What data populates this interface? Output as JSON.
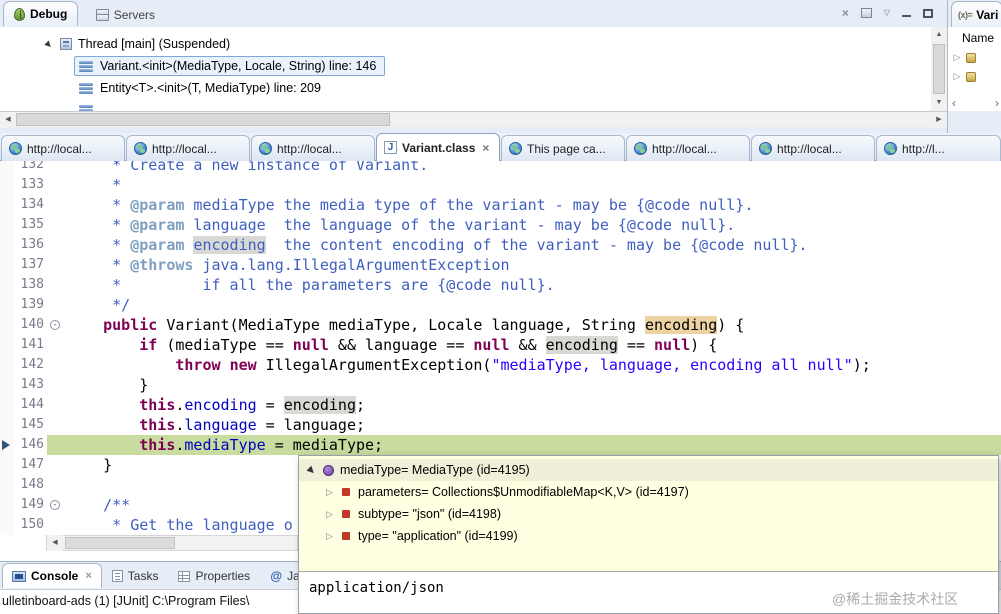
{
  "debug_view": {
    "tabs": [
      {
        "label": "Debug",
        "icon": "bug-icon",
        "active": true
      },
      {
        "label": "Servers",
        "icon": "servers-icon",
        "active": false
      }
    ],
    "toolbar_icons": [
      "remove-terminated-icon",
      "window-icon",
      "view-menu-icon",
      "minimize-icon",
      "maximize-icon"
    ],
    "thread_label": "Thread [main] (Suspended)",
    "frames": [
      {
        "label": "Variant.<init>(MediaType, Locale, String) line: 146",
        "selected": true
      },
      {
        "label": "Entity<T>.<init>(T, MediaType) line: 209",
        "selected": false
      }
    ]
  },
  "variables_view": {
    "tab_icon": "(x)=",
    "tab_label": "Vari",
    "name_header": "Name"
  },
  "editor": {
    "tabs": [
      {
        "label": "http://local...",
        "icon": "globe",
        "active": false
      },
      {
        "label": "http://local...",
        "icon": "globe",
        "active": false
      },
      {
        "label": "http://local...",
        "icon": "globe",
        "active": false
      },
      {
        "label": "Variant.class",
        "icon": "java-class",
        "active": true
      },
      {
        "label": "This page ca...",
        "icon": "globe",
        "active": false
      },
      {
        "label": "http://local...",
        "icon": "globe",
        "active": false
      },
      {
        "label": "http://local...",
        "icon": "globe",
        "active": false
      },
      {
        "label": "http://l...",
        "icon": "globe",
        "active": false
      }
    ],
    "code_lines": [
      {
        "num": "132",
        "tokens": [
          [
            "doc",
            "     * Create a new instance of Variant."
          ]
        ]
      },
      {
        "num": "133",
        "tokens": [
          [
            "doc",
            "     *"
          ]
        ]
      },
      {
        "num": "134",
        "tokens": [
          [
            "doc",
            "     * "
          ],
          [
            "doctag",
            "@param"
          ],
          [
            "doc",
            " mediaType the media type of the variant - may be {@code null}."
          ]
        ]
      },
      {
        "num": "135",
        "tokens": [
          [
            "doc",
            "     * "
          ],
          [
            "doctag",
            "@param"
          ],
          [
            "doc",
            " language  the language of the variant - may be {@code null}."
          ]
        ]
      },
      {
        "num": "136",
        "tokens": [
          [
            "doc",
            "     * "
          ],
          [
            "doctag",
            "@param"
          ],
          [
            "doc",
            " "
          ],
          [
            "docw",
            "encoding"
          ],
          [
            "doc",
            "  the content encoding of the variant - may be {@code null}."
          ]
        ]
      },
      {
        "num": "137",
        "tokens": [
          [
            "doc",
            "     * "
          ],
          [
            "doctag",
            "@throws"
          ],
          [
            "doc",
            " java.lang.IllegalArgumentException"
          ]
        ]
      },
      {
        "num": "138",
        "tokens": [
          [
            "doc",
            "     *         if all the parameters are {@code null}."
          ]
        ]
      },
      {
        "num": "139",
        "tokens": [
          [
            "doc",
            "     */"
          ]
        ]
      },
      {
        "num": "140",
        "fold": true,
        "tokens": [
          [
            "plain",
            "    "
          ],
          [
            "kw",
            "public"
          ],
          [
            "plain",
            " Variant(MediaType mediaType, Locale language, String "
          ],
          [
            "occw",
            "encoding"
          ],
          [
            "plain",
            ") {"
          ]
        ]
      },
      {
        "num": "141",
        "tokens": [
          [
            "plain",
            "        "
          ],
          [
            "kw",
            "if"
          ],
          [
            "plain",
            " (mediaType == "
          ],
          [
            "kw",
            "null"
          ],
          [
            "plain",
            " && language == "
          ],
          [
            "kw",
            "null"
          ],
          [
            "plain",
            " && "
          ],
          [
            "occ",
            "encoding"
          ],
          [
            "plain",
            " == "
          ],
          [
            "kw",
            "null"
          ],
          [
            "plain",
            ") {"
          ]
        ]
      },
      {
        "num": "142",
        "tokens": [
          [
            "plain",
            "            "
          ],
          [
            "kw",
            "throw"
          ],
          [
            "plain",
            " "
          ],
          [
            "kw",
            "new"
          ],
          [
            "plain",
            " IllegalArgumentException("
          ],
          [
            "str",
            "\"mediaType, language, encoding all null\""
          ],
          [
            "plain",
            ");"
          ]
        ]
      },
      {
        "num": "143",
        "tokens": [
          [
            "plain",
            "        }"
          ]
        ]
      },
      {
        "num": "144",
        "tokens": [
          [
            "plain",
            "        "
          ],
          [
            "kw",
            "this"
          ],
          [
            "plain",
            "."
          ],
          [
            "field",
            "encoding"
          ],
          [
            "plain",
            " = "
          ],
          [
            "occ",
            "encoding"
          ],
          [
            "plain",
            ";"
          ]
        ]
      },
      {
        "num": "145",
        "tokens": [
          [
            "plain",
            "        "
          ],
          [
            "kw",
            "this"
          ],
          [
            "plain",
            "."
          ],
          [
            "field",
            "language"
          ],
          [
            "plain",
            " = language;"
          ]
        ]
      },
      {
        "num": "146",
        "current": true,
        "tokens": [
          [
            "plain",
            "        "
          ],
          [
            "kw",
            "this"
          ],
          [
            "plain",
            "."
          ],
          [
            "field",
            "mediaType"
          ],
          [
            "plain",
            " = mediaType;"
          ]
        ]
      },
      {
        "num": "147",
        "tokens": [
          [
            "plain",
            "    }"
          ]
        ]
      },
      {
        "num": "148",
        "tokens": []
      },
      {
        "num": "149",
        "fold": true,
        "tokens": [
          [
            "doc",
            "    /**"
          ]
        ]
      },
      {
        "num": "150",
        "tokens": [
          [
            "doc",
            "     * Get the language o"
          ]
        ]
      }
    ]
  },
  "inspect_popup": {
    "rows": [
      {
        "label": "mediaType= MediaType (id=4195)",
        "expanded": true,
        "icon": "value"
      },
      {
        "label": "parameters= Collections$UnmodifiableMap<K,V> (id=4197)",
        "expanded": false,
        "icon": "private-field"
      },
      {
        "label": "subtype= \"json\" (id=4198)",
        "expanded": false,
        "icon": "private-field"
      },
      {
        "label": "type= \"application\" (id=4199)",
        "expanded": false,
        "icon": "private-field"
      }
    ],
    "value_text": "application/json"
  },
  "bottom_view": {
    "tabs": [
      {
        "label": "Console",
        "icon": "console-icon",
        "active": true
      },
      {
        "label": "Tasks",
        "icon": "tasks-icon",
        "active": false
      },
      {
        "label": "Properties",
        "icon": "properties-icon",
        "active": false
      },
      {
        "label": "Jav",
        "icon": "javadoc-icon",
        "active": false
      }
    ],
    "status_line": "ulletinboard-ads (1) [JUnit] C:\\Program Files\\"
  },
  "watermark": "@稀土掘金技术社区",
  "palette": {
    "current_line_green": "#C8DCA0",
    "occurrence_read": "#D8D9D4",
    "occurrence_write": "#EDD3A1",
    "popup_background": "#FFFFE1",
    "keyword": "#7F0055",
    "javadoc": "#3F5FBF",
    "string": "#2A00FF",
    "field": "#0000C0"
  }
}
